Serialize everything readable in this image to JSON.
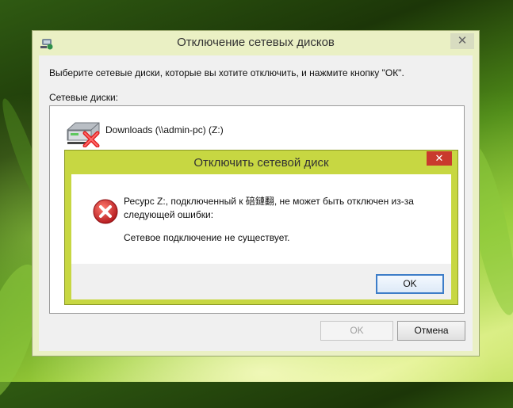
{
  "main_dialog": {
    "title": "Отключение сетевых дисков",
    "close_glyph": "✕",
    "instruction": "Выберите сетевые диски, которые вы хотите отключить, и нажмите кнопку \"ОК\".",
    "drives_label": "Сетевые диски:",
    "drives": [
      {
        "label": "Downloads (\\\\admin-pc) (Z:)",
        "icon": "disconnected-network-drive-icon"
      }
    ],
    "ok_label": "OK",
    "cancel_label": "Отмена"
  },
  "error_dialog": {
    "title": "Отключить сетевой диск",
    "close_glyph": "✕",
    "icon": "error-icon",
    "message": "Ресурс Z:, подключенный к 碚鏈翻, не может быть отключен из-за следующей ошибки:",
    "detail": "Сетевое подключение не существует.",
    "ok_label": "OK"
  },
  "colors": {
    "error_accent": "#c7d742",
    "close_red": "#c93a2d",
    "focus_blue": "#3d7dc8"
  }
}
